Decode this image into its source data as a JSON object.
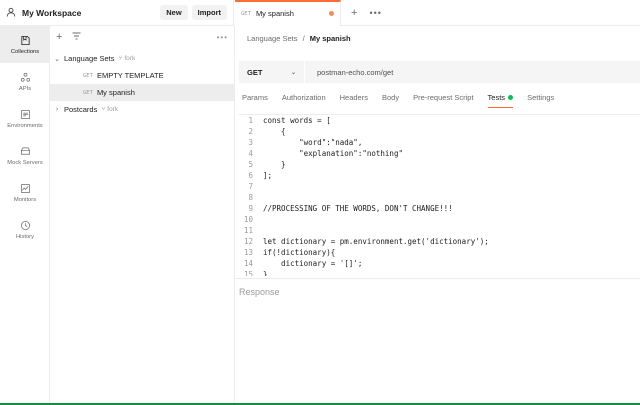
{
  "workspace": {
    "title": "My Workspace",
    "new_label": "New",
    "import_label": "Import"
  },
  "tabbar": {
    "tabs": [
      {
        "method": "GET",
        "title": "My spanish"
      }
    ]
  },
  "rail": [
    {
      "label": "Collections",
      "icon": "collections-icon"
    },
    {
      "label": "APIs",
      "icon": "apis-icon"
    },
    {
      "label": "Environments",
      "icon": "environments-icon"
    },
    {
      "label": "Mock Servers",
      "icon": "mock-servers-icon"
    },
    {
      "label": "Monitors",
      "icon": "monitors-icon"
    },
    {
      "label": "History",
      "icon": "history-icon"
    }
  ],
  "tree": {
    "collections": [
      {
        "name": "Language Sets",
        "tag": "fork",
        "expanded": true
      },
      {
        "name": "Postcards",
        "tag": "fork",
        "expanded": false
      }
    ],
    "requests": [
      {
        "method": "GET",
        "name": "EMPTY TEMPLATE"
      },
      {
        "method": "GET",
        "name": "My spanish"
      }
    ]
  },
  "breadcrumb": {
    "parent": "Language Sets",
    "sep": "/",
    "current": "My spanish"
  },
  "request": {
    "method": "GET",
    "url": "postman-echo.com/get"
  },
  "subtabs": [
    "Params",
    "Authorization",
    "Headers",
    "Body",
    "Pre-request Script",
    "Tests",
    "Settings"
  ],
  "active_subtab": "Tests",
  "code": [
    {
      "n": "1",
      "text": "const words = ["
    },
    {
      "n": "2",
      "text": "    {"
    },
    {
      "n": "3",
      "text": "        \"word\":\"nada\","
    },
    {
      "n": "4",
      "text": "        \"explanation\":\"nothing\""
    },
    {
      "n": "5",
      "text": "    }"
    },
    {
      "n": "6",
      "text": "];"
    },
    {
      "n": "7",
      "text": ""
    },
    {
      "n": "8",
      "text": ""
    },
    {
      "n": "9",
      "text": "//PROCESSING OF THE WORDS, DON'T CHANGE!!!"
    },
    {
      "n": "10",
      "text": ""
    },
    {
      "n": "11",
      "text": ""
    },
    {
      "n": "12",
      "text": "let dictionary = pm.environment.get('dictionary');"
    },
    {
      "n": "13",
      "text": "if(!dictionary){"
    },
    {
      "n": "14",
      "text": "    dictionary = '[]';"
    },
    {
      "n": "15",
      "text": "}"
    }
  ],
  "response_label": "Response",
  "colors": {
    "accent": "#ff6c37",
    "tests_dot": "#0cbb52",
    "status_bar": "#1a8a3d"
  }
}
